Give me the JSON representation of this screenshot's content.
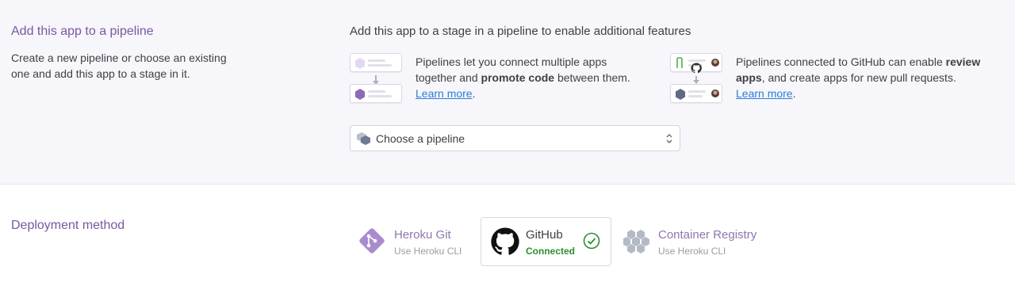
{
  "pipeline": {
    "title": "Add this app to a pipeline",
    "description": "Create a new pipeline or choose an existing one and add this app to a stage in it.",
    "intro": "Add this app to a stage in a pipeline to enable additional features",
    "feature_promote": {
      "text_before": "Pipelines let you connect multiple apps together and ",
      "bold": "promote code",
      "text_after": " between them.",
      "link": "Learn more",
      "link_suffix": "."
    },
    "feature_review": {
      "text_before": "Pipelines connected to GitHub can enable ",
      "bold": "review apps",
      "text_after": ", and create apps for new pull requests.",
      "link": "Learn more",
      "link_suffix": "."
    },
    "select": {
      "label": "Choose a pipeline",
      "icon": "pipeline-hex-icon"
    }
  },
  "deployment": {
    "title": "Deployment method",
    "methods": [
      {
        "name": "Heroku Git",
        "sub": "Use Heroku CLI",
        "icon": "git-icon",
        "active": false
      },
      {
        "name": "GitHub",
        "sub": "Connected",
        "icon": "github-icon",
        "active": true,
        "status_icon": "check-circle-icon"
      },
      {
        "name": "Container Registry",
        "sub": "Use Heroku CLI",
        "icon": "container-icon",
        "active": false
      }
    ]
  },
  "colors": {
    "accent_purple": "#79589f",
    "link_blue": "#2d7cd6",
    "connected_green": "#2a8f2f",
    "section_bg": "#f7f6fb"
  }
}
